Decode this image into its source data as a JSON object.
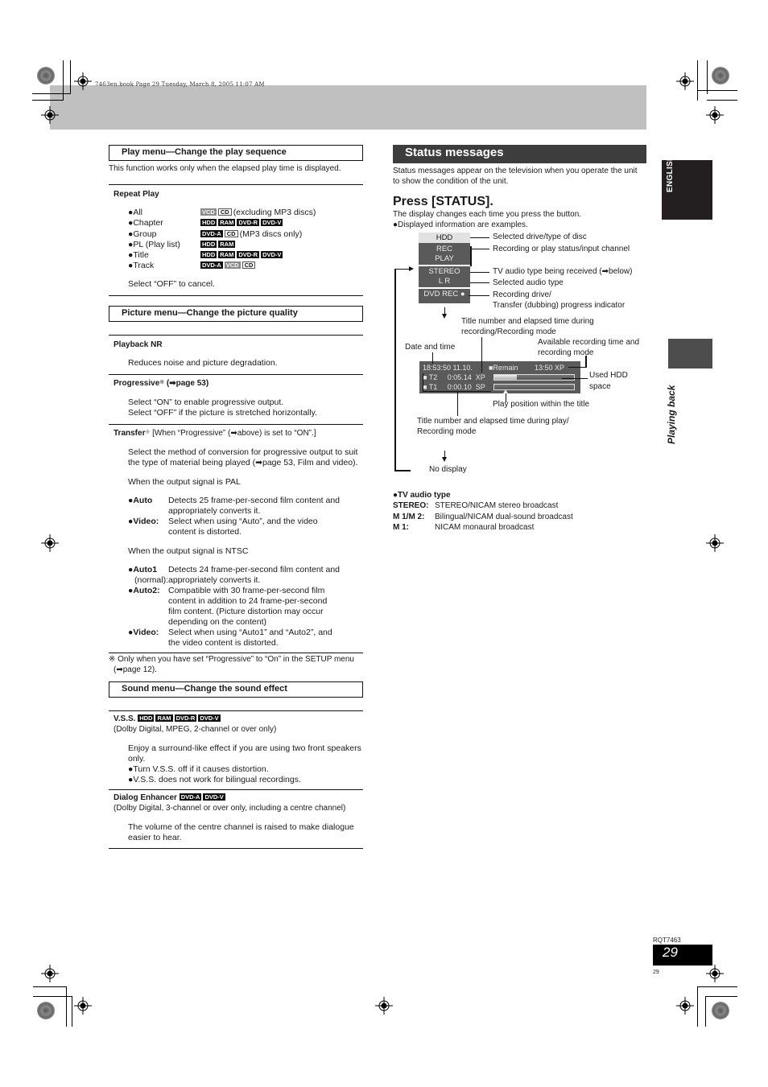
{
  "print_meta": "7463en.book  Page 29  Tuesday, March 8, 2005  11:07 AM",
  "left": {
    "play_menu": {
      "heading": "Play menu—Change the play sequence",
      "intro": "This function works only when the elapsed play time is displayed.",
      "repeat_play": {
        "title": "Repeat Play",
        "rows": [
          {
            "label": "●All",
            "badges": [
              {
                "t": "VCD",
                "s": "grey"
              },
              {
                "t": "CD",
                "s": "outline"
              }
            ],
            "note": "(excluding MP3 discs)"
          },
          {
            "label": "●Chapter",
            "badges": [
              {
                "t": "HDD",
                "s": "black"
              },
              {
                "t": "RAM",
                "s": "black"
              },
              {
                "t": "DVD-R",
                "s": "black"
              },
              {
                "t": "DVD-V",
                "s": "black"
              }
            ],
            "note": ""
          },
          {
            "label": "●Group",
            "badges": [
              {
                "t": "DVD-A",
                "s": "black"
              },
              {
                "t": "CD",
                "s": "outline"
              }
            ],
            "note": "(MP3 discs only)"
          },
          {
            "label": "●PL (Play list)",
            "badges": [
              {
                "t": "HDD",
                "s": "black"
              },
              {
                "t": "RAM",
                "s": "black"
              }
            ],
            "note": ""
          },
          {
            "label": "●Title",
            "badges": [
              {
                "t": "HDD",
                "s": "black"
              },
              {
                "t": "RAM",
                "s": "black"
              },
              {
                "t": "DVD-R",
                "s": "black"
              },
              {
                "t": "DVD-V",
                "s": "black"
              }
            ],
            "note": ""
          },
          {
            "label": "●Track",
            "badges": [
              {
                "t": "DVD-A",
                "s": "black"
              },
              {
                "t": "VCD",
                "s": "grey"
              },
              {
                "t": "CD",
                "s": "outline"
              }
            ],
            "note": ""
          }
        ],
        "cancel": "Select “OFF” to cancel."
      }
    },
    "picture_menu": {
      "heading": "Picture menu—Change the picture quality",
      "playback_nr": {
        "title": "Playback NR",
        "text": "Reduces noise and picture degradation."
      },
      "progressive": {
        "title": "Progressive",
        "mark": "※",
        "ref": "(➡page 53)",
        "line1": "Select “ON” to enable progressive output.",
        "line2": "Select “OFF” if the picture is stretched horizontally."
      },
      "transfer": {
        "title": "Transfer",
        "mark": "※",
        "condition": "[When “Progressive” (➡above) is set to “ON”.]",
        "text1": "Select the method of conversion for progressive output to suit",
        "text2": "the type of material being played (➡page 53, Film and video).",
        "pal_label": "When the output signal is PAL",
        "pal": [
          {
            "term": "●Auto",
            "sub": "",
            "desc": [
              "Detects 25 frame-per-second film content and",
              "appropriately converts it."
            ]
          },
          {
            "term": "●Video:",
            "sub": "",
            "desc": [
              "Select when using “Auto”, and the video",
              "content is distorted."
            ]
          }
        ],
        "ntsc_label": "When the output signal is NTSC",
        "ntsc": [
          {
            "term": "●Auto1",
            "sub": "(normal):",
            "desc": [
              "Detects 24 frame-per-second film content and",
              "appropriately converts it."
            ]
          },
          {
            "term": "●Auto2:",
            "sub": "",
            "desc": [
              "Compatible with 30 frame-per-second film",
              "content in addition to 24 frame-per-second",
              "film content. (Picture distortion may occur",
              "depending on the content)"
            ]
          },
          {
            "term": "●Video:",
            "sub": "",
            "desc": [
              "Select when using “Auto1” and “Auto2”, and",
              "the video content is distorted."
            ]
          }
        ]
      },
      "footnote1": "※ Only when you have set “Progressive” to “On” in the SETUP menu",
      "footnote2": "(➡page 12)."
    },
    "sound_menu": {
      "heading": "Sound menu—Change the sound effect",
      "vss": {
        "title": "V.S.S.",
        "badges": [
          "HDD",
          "RAM",
          "DVD-R",
          "DVD-V"
        ],
        "condition": "(Dolby Digital, MPEG, 2-channel or over only)",
        "text1": "Enjoy a surround-like effect if you are using two front speakers",
        "text2": "only.",
        "bullet1": "●Turn V.S.S. off if it causes distortion.",
        "bullet2": "●V.S.S. does not work for bilingual recordings."
      },
      "dialog": {
        "title": "Dialog Enhancer",
        "badges": [
          "DVD-A",
          "DVD-V"
        ],
        "condition": "(Dolby Digital, 3-channel or over only, including a centre channel)",
        "text1": "The volume of the centre channel is raised to make dialogue",
        "text2": "easier to hear."
      }
    }
  },
  "right": {
    "title": "Status messages",
    "intro1": "Status messages appear on the television when you operate the unit",
    "intro2": "to show the condition of the unit.",
    "press": "Press [STATUS].",
    "changes": "The display changes each time you press the button.",
    "examples": "●Displayed information are examples.",
    "osd": {
      "drive": "HDD",
      "rec": "REC",
      "play": "PLAY",
      "stereo": "STEREO",
      "lr": "L R",
      "dvdrec": "DVD REC ●"
    },
    "callouts": {
      "drive": "Selected drive/type of disc",
      "status": "Recording or play status/input channel",
      "tv_audio": "TV audio type being received (➡below)",
      "audio_type": "Selected audio type",
      "rec_drive1": "Recording drive/",
      "rec_drive2": "Transfer (dubbing) progress indicator",
      "title_rec1": "Title number and elapsed time during",
      "title_rec2": "recording/Recording mode",
      "date_time": "Date and time",
      "avail1": "Available recording time and",
      "avail2": "recording mode",
      "used_hdd1": "Used HDD",
      "used_hdd2": "space",
      "play_pos": "Play position within the title",
      "title_play1": "Title number and elapsed time during play/",
      "title_play2": "Recording mode",
      "no_display": "No display"
    },
    "osd_wide": {
      "datetime": "18:53:50 11.10.",
      "remain_label": "■Remain",
      "remain_value": "13:50  XP",
      "t2": "■ T2     0:05.14  XP",
      "t1": "■ T1     0:00.10  SP",
      "hdd_used_fraction": 0.28
    },
    "tv_audio": {
      "title": "●TV audio type",
      "rows": [
        {
          "k": "STEREO:",
          "v": "STEREO/NICAM stereo broadcast"
        },
        {
          "k": "M 1/M 2:",
          "v": "Bilingual/NICAM dual-sound broadcast"
        },
        {
          "k": "M 1:",
          "v": "NICAM monaural broadcast"
        }
      ]
    }
  },
  "side": {
    "language_tab": "ENGLISH",
    "section_tab": "Playing back"
  },
  "footer": {
    "code": "RQT7463",
    "page": "29",
    "page_small": "29"
  }
}
